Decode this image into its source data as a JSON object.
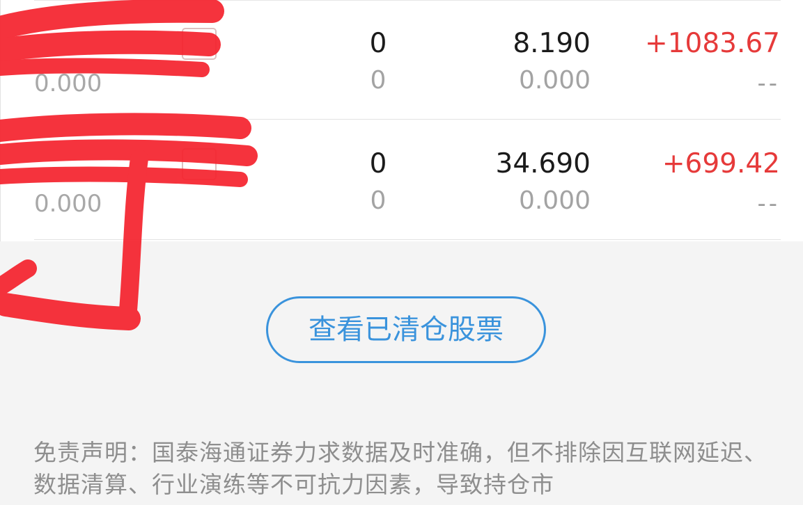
{
  "holdings": [
    {
      "sub_value": "0.000",
      "qty": "0",
      "qty_sub": "0",
      "price": "8.190",
      "price_sub": "0.000",
      "profit_loss": "+1083.67",
      "profit_loss_sub": "--"
    },
    {
      "sub_value": "0.000",
      "qty": "0",
      "qty_sub": "0",
      "price": "34.690",
      "price_sub": "0.000",
      "profit_loss": "+699.42",
      "profit_loss_sub": "--"
    }
  ],
  "view_cleared_button": "查看已清仓股票",
  "disclaimer": "免责声明：国泰海通证券力求数据及时准确，但不排除因互联网延迟、数据清算、行业演练等不可抗力因素，导致持仓市",
  "colors": {
    "gain": "#e63a3a",
    "accent": "#3a93dc",
    "redaction": "#f5222d"
  }
}
